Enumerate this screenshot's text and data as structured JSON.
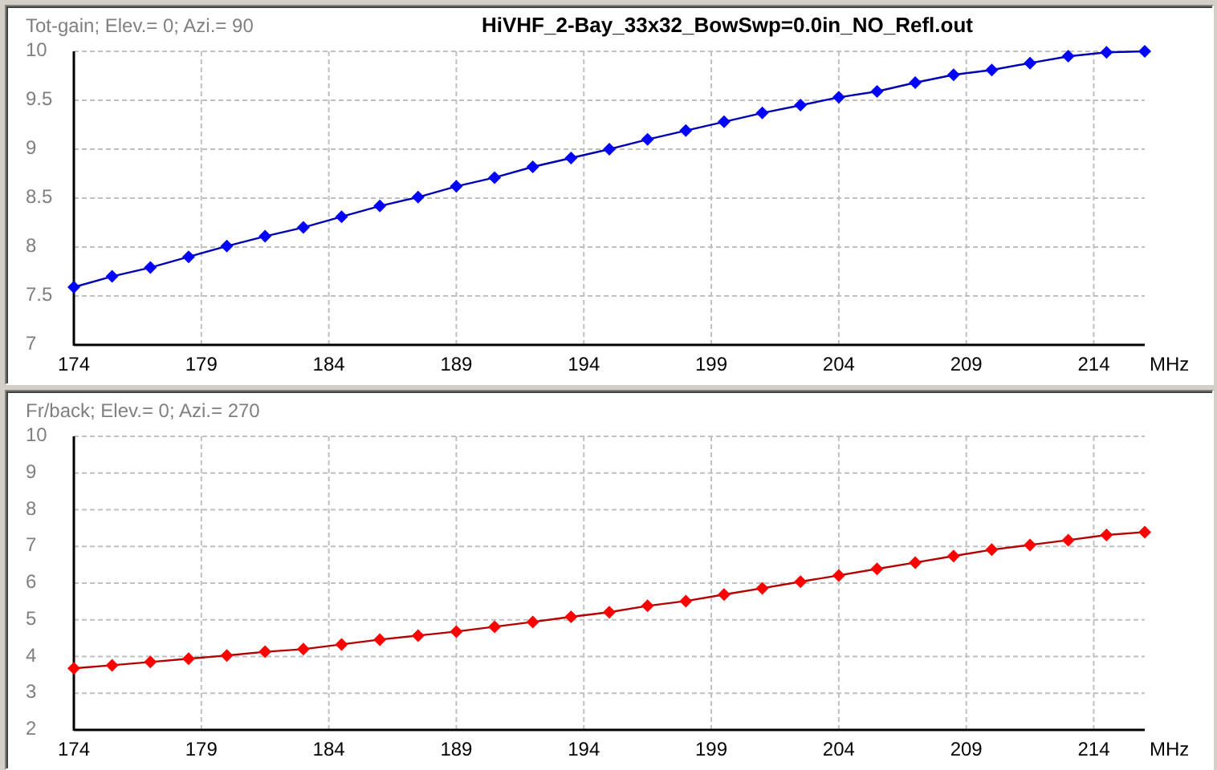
{
  "file_title": "HiVHF_2-Bay_33x32_BowSwp=0.0in_NO_Refl.out",
  "charts": [
    {
      "chart_data": {
        "type": "line",
        "title": "Tot-gain; Elev.= 0; Azi.= 90",
        "xlabel": "MHz",
        "x": [
          174,
          175.5,
          177,
          178.5,
          180,
          181.5,
          183,
          184.5,
          186,
          187.5,
          189,
          190.5,
          192,
          193.5,
          195,
          196.5,
          198,
          199.5,
          201,
          202.5,
          204,
          205.5,
          207,
          208.5,
          210,
          211.5,
          213,
          214.5,
          216
        ],
        "grid": true,
        "series": [
          {
            "color": "#0000ff",
            "marker": "diamond",
            "values": [
              7.59,
              7.7,
              7.79,
              7.9,
              8.01,
              8.11,
              8.2,
              8.31,
              8.42,
              8.51,
              8.62,
              8.71,
              8.82,
              8.91,
              9.0,
              9.1,
              9.19,
              9.28,
              9.37,
              9.45,
              9.53,
              9.59,
              9.68,
              9.76,
              9.81,
              9.88,
              9.95,
              9.99,
              10.0
            ]
          }
        ],
        "xlim": [
          174,
          216
        ],
        "ylim": [
          7,
          10
        ],
        "xticks": [
          174,
          179,
          184,
          189,
          194,
          199,
          204,
          209,
          214
        ],
        "yticks": [
          7,
          7.5,
          8,
          8.5,
          9,
          9.5,
          10
        ]
      }
    },
    {
      "chart_data": {
        "type": "line",
        "title": "Fr/back; Elev.= 0; Azi.= 270",
        "xlabel": "MHz",
        "x": [
          174,
          175.5,
          177,
          178.5,
          180,
          181.5,
          183,
          184.5,
          186,
          187.5,
          189,
          190.5,
          192,
          193.5,
          195,
          196.5,
          198,
          199.5,
          201,
          202.5,
          204,
          205.5,
          207,
          208.5,
          210,
          211.5,
          213,
          214.5,
          216
        ],
        "grid": true,
        "series": [
          {
            "color": "#ff0000",
            "marker": "diamond",
            "values": [
              3.68,
              3.76,
              3.85,
              3.94,
              4.03,
              4.13,
              4.2,
              4.33,
              4.46,
              4.57,
              4.68,
              4.81,
              4.94,
              5.08,
              5.21,
              5.38,
              5.51,
              5.69,
              5.86,
              6.04,
              6.21,
              6.39,
              6.56,
              6.74,
              6.91,
              7.04,
              7.17,
              7.31,
              7.39
            ]
          }
        ],
        "xlim": [
          174,
          216
        ],
        "ylim": [
          2,
          10
        ],
        "xticks": [
          174,
          179,
          184,
          189,
          194,
          199,
          204,
          209,
          214
        ],
        "yticks": [
          2,
          3,
          4,
          5,
          6,
          7,
          8,
          9,
          10
        ]
      }
    }
  ]
}
